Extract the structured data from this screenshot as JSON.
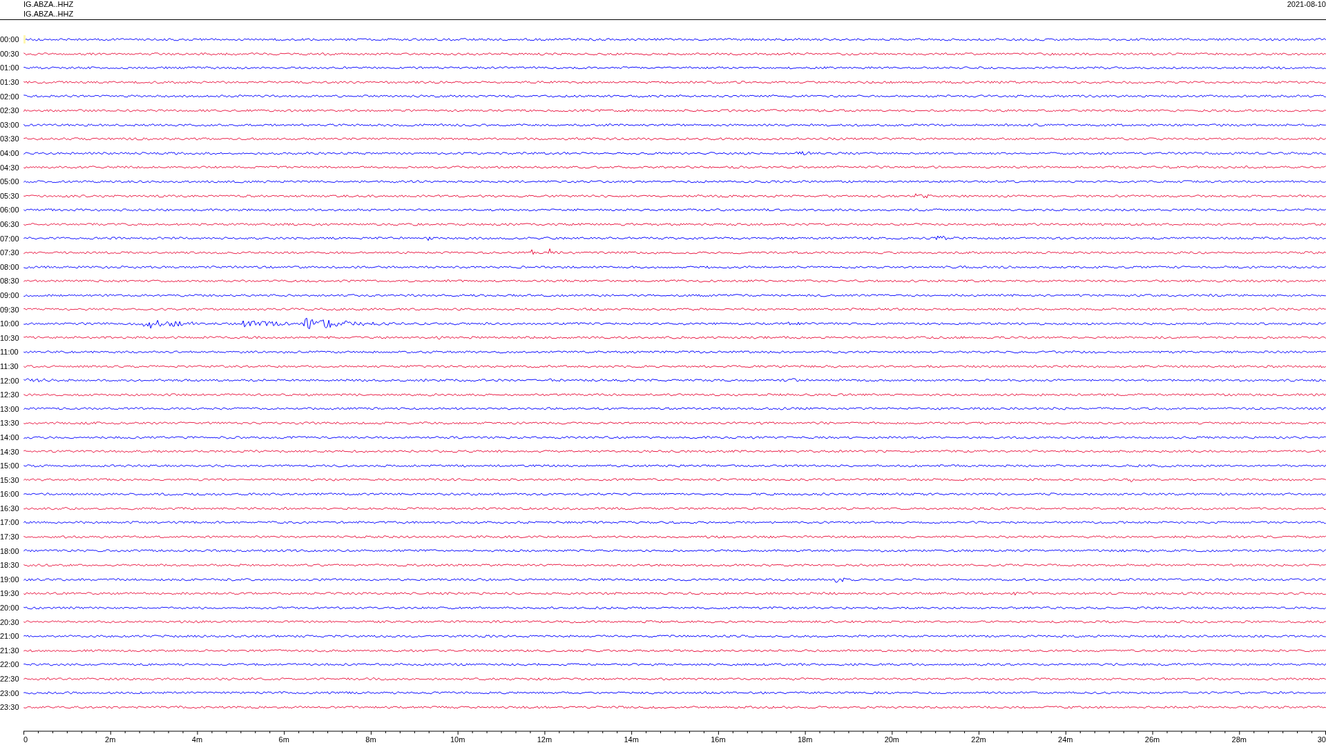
{
  "header": {
    "channel_lines": [
      "IG.ABZA..HHZ",
      "IG.ABZA..HHZ"
    ],
    "date": "2021-08-10"
  },
  "traces": [
    {
      "time": "00:00",
      "color": "#0000ff"
    },
    {
      "time": "00:30",
      "color": "#e8103c"
    },
    {
      "time": "01:00",
      "color": "#0000ff"
    },
    {
      "time": "01:30",
      "color": "#e8103c"
    },
    {
      "time": "02:00",
      "color": "#0000ff"
    },
    {
      "time": "02:30",
      "color": "#e8103c"
    },
    {
      "time": "03:00",
      "color": "#0000ff"
    },
    {
      "time": "03:30",
      "color": "#e8103c"
    },
    {
      "time": "04:00",
      "color": "#0000ff"
    },
    {
      "time": "04:30",
      "color": "#e8103c"
    },
    {
      "time": "05:00",
      "color": "#0000ff"
    },
    {
      "time": "05:30",
      "color": "#e8103c"
    },
    {
      "time": "06:00",
      "color": "#0000ff"
    },
    {
      "time": "06:30",
      "color": "#e8103c"
    },
    {
      "time": "07:00",
      "color": "#0000ff"
    },
    {
      "time": "07:30",
      "color": "#e8103c"
    },
    {
      "time": "08:00",
      "color": "#0000ff"
    },
    {
      "time": "08:30",
      "color": "#e8103c"
    },
    {
      "time": "09:00",
      "color": "#0000ff"
    },
    {
      "time": "09:30",
      "color": "#e8103c"
    },
    {
      "time": "10:00",
      "color": "#0000ff"
    },
    {
      "time": "10:30",
      "color": "#e8103c"
    },
    {
      "time": "11:00",
      "color": "#0000ff"
    },
    {
      "time": "11:30",
      "color": "#e8103c"
    },
    {
      "time": "12:00",
      "color": "#0000ff"
    },
    {
      "time": "12:30",
      "color": "#e8103c"
    },
    {
      "time": "13:00",
      "color": "#0000ff"
    },
    {
      "time": "13:30",
      "color": "#e8103c"
    },
    {
      "time": "14:00",
      "color": "#0000ff"
    },
    {
      "time": "14:30",
      "color": "#e8103c"
    },
    {
      "time": "15:00",
      "color": "#0000ff"
    },
    {
      "time": "15:30",
      "color": "#e8103c"
    },
    {
      "time": "16:00",
      "color": "#0000ff"
    },
    {
      "time": "16:30",
      "color": "#e8103c"
    },
    {
      "time": "17:00",
      "color": "#0000ff"
    },
    {
      "time": "17:30",
      "color": "#e8103c"
    },
    {
      "time": "18:00",
      "color": "#0000ff"
    },
    {
      "time": "18:30",
      "color": "#e8103c"
    },
    {
      "time": "19:00",
      "color": "#0000ff"
    },
    {
      "time": "19:30",
      "color": "#e8103c"
    },
    {
      "time": "20:00",
      "color": "#0000ff"
    },
    {
      "time": "20:30",
      "color": "#e8103c"
    },
    {
      "time": "21:00",
      "color": "#0000ff"
    },
    {
      "time": "21:30",
      "color": "#e8103c"
    },
    {
      "time": "22:00",
      "color": "#0000ff"
    },
    {
      "time": "22:30",
      "color": "#e8103c"
    },
    {
      "time": "23:00",
      "color": "#0000ff"
    },
    {
      "time": "23:30",
      "color": "#e8103c"
    }
  ],
  "x_axis": {
    "labels": [
      "0",
      "2m",
      "4m",
      "6m",
      "8m",
      "10m",
      "12m",
      "14m",
      "16m",
      "18m",
      "20m",
      "22m",
      "24m",
      "26m",
      "28m",
      "30"
    ]
  }
}
